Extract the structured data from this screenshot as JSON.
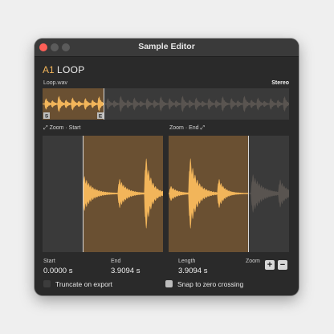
{
  "window": {
    "title": "Sample Editor"
  },
  "sample": {
    "slot": "A1",
    "mode": "LOOP",
    "filename": "Loop.wav",
    "channels": "Stereo"
  },
  "markers": {
    "start": "S",
    "end": "E"
  },
  "zoom_views": {
    "start_label": "Zoom · Start",
    "end_label": "Zoom · End"
  },
  "fields": {
    "start": {
      "label": "Start",
      "value": "0.0000 s"
    },
    "end": {
      "label": "End",
      "value": "3.9094 s"
    },
    "length": {
      "label": "Length",
      "value": "3.9094 s"
    },
    "zoom": {
      "label": "Zoom",
      "plus": "+",
      "minus": "−"
    }
  },
  "options": {
    "truncate": {
      "label": "Truncate on export",
      "checked": false
    },
    "snap": {
      "label": "Snap to zero crossing",
      "checked": false
    }
  },
  "colors": {
    "accent": "#f2b55a",
    "selection": "#6a5032",
    "waveform_dim": "#595450",
    "close_button": "#fe5f57",
    "checkbox_on": "#bdbdbd",
    "checkbox_off": "#3c3c3c"
  }
}
